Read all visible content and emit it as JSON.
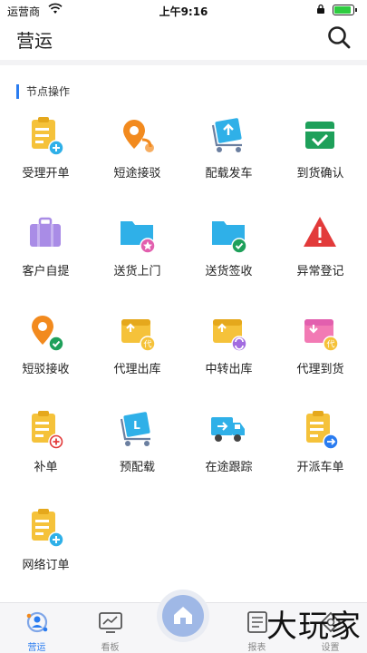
{
  "status_bar": {
    "carrier": "运营商",
    "time": "上午9:16"
  },
  "header": {
    "title": "营运",
    "search_icon": "search-icon"
  },
  "section": {
    "label": "节点操作"
  },
  "items": [
    {
      "label": "受理开单",
      "icon": "clipboard-add-icon"
    },
    {
      "label": "短途接驳",
      "icon": "location-pin-transfer-icon"
    },
    {
      "label": "配载发车",
      "icon": "cart-upload-icon"
    },
    {
      "label": "到货确认",
      "icon": "clipboard-check-icon"
    },
    {
      "label": "客户自提",
      "icon": "suitcase-icon"
    },
    {
      "label": "送货上门",
      "icon": "folder-star-icon"
    },
    {
      "label": "送货签收",
      "icon": "folder-check-icon"
    },
    {
      "label": "异常登记",
      "icon": "warning-icon"
    },
    {
      "label": "短驳接收",
      "icon": "location-pin-check-icon"
    },
    {
      "label": "代理出库",
      "icon": "box-out-agent-icon"
    },
    {
      "label": "中转出库",
      "icon": "box-transfer-icon"
    },
    {
      "label": "代理到货",
      "icon": "box-in-agent-icon"
    },
    {
      "label": "补单",
      "icon": "clipboard-plus-icon"
    },
    {
      "label": "预配载",
      "icon": "cart-preload-icon"
    },
    {
      "label": "在途跟踪",
      "icon": "truck-icon"
    },
    {
      "label": "开派车单",
      "icon": "clipboard-arrow-icon"
    },
    {
      "label": "网络订单",
      "icon": "clipboard-network-add-icon"
    }
  ],
  "tabbar": {
    "tabs": [
      {
        "label": "营运",
        "icon": "operations-icon",
        "active": true
      },
      {
        "label": "看板",
        "icon": "dashboard-icon",
        "active": false
      },
      {
        "label": "",
        "icon": "home-icon",
        "active": false
      },
      {
        "label": "报表",
        "icon": "report-icon",
        "active": false
      },
      {
        "label": "设置",
        "icon": "settings-icon",
        "active": false
      }
    ]
  },
  "watermark": "大玩家",
  "colors": {
    "accent": "#2a7cf0",
    "yellow": "#f5c23a",
    "orange": "#f28a1e",
    "green": "#1ea05a",
    "purple": "#a98ce6",
    "red": "#e23a3a",
    "teal": "#2fb0e8"
  }
}
